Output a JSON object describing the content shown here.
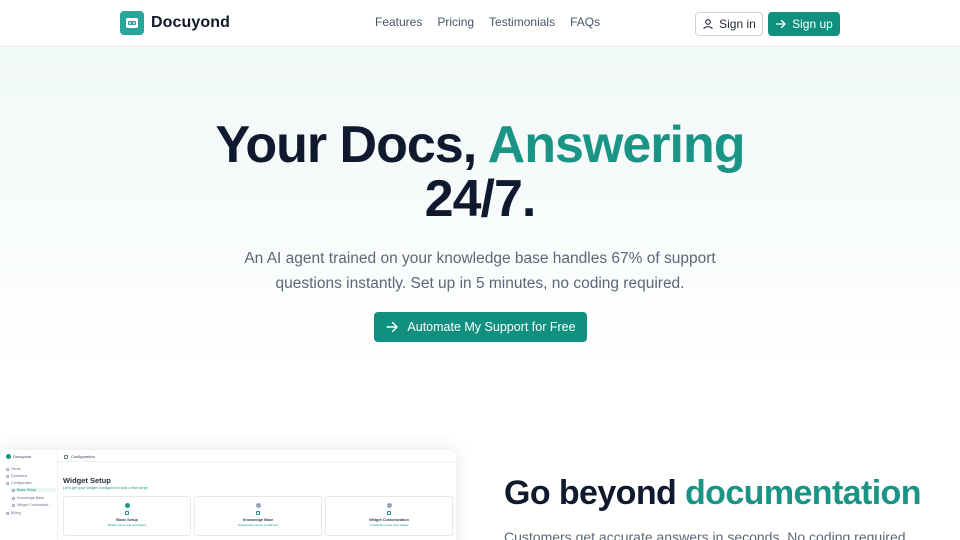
{
  "header": {
    "brand": "Docuyond",
    "nav": [
      "Features",
      "Pricing",
      "Testimonials",
      "FAQs"
    ],
    "sign_in": "Sign in",
    "sign_up": "Sign up"
  },
  "hero": {
    "title_part1": "Your Docs, ",
    "title_accent": "Answering",
    "title_part2": "24/7.",
    "subtitle": "An AI agent trained on your knowledge base handles 67% of support questions instantly. Set up in 5 minutes, no coding required.",
    "cta": "Automate My Support for Free"
  },
  "preview": {
    "brand": "Docuyond",
    "breadcrumb": "Configuration",
    "sidebar": [
      "Home",
      "Questions",
      "Configuration",
      "Basic Setup",
      "Knowledge Base",
      "Widget Customizati...",
      "Billing"
    ],
    "heading": "Widget Setup",
    "subheading": "Let's get your widget configured in just a few steps",
    "cards": [
      {
        "step": "1",
        "title": "Basic Setup",
        "desc": "Widget name and description"
      },
      {
        "step": "2",
        "title": "Knowledge Base",
        "desc": "Upload documents or add text"
      },
      {
        "step": "3",
        "title": "Widget Customization",
        "desc": "Customize & test your widget"
      }
    ]
  },
  "section": {
    "title_part1": "Go beyond ",
    "title_accent": "documentation",
    "subtitle": "Customers get accurate answers in seconds. No coding required."
  },
  "colors": {
    "accent": "#1a9484",
    "button": "#12907f",
    "heading": "#101a2e"
  }
}
